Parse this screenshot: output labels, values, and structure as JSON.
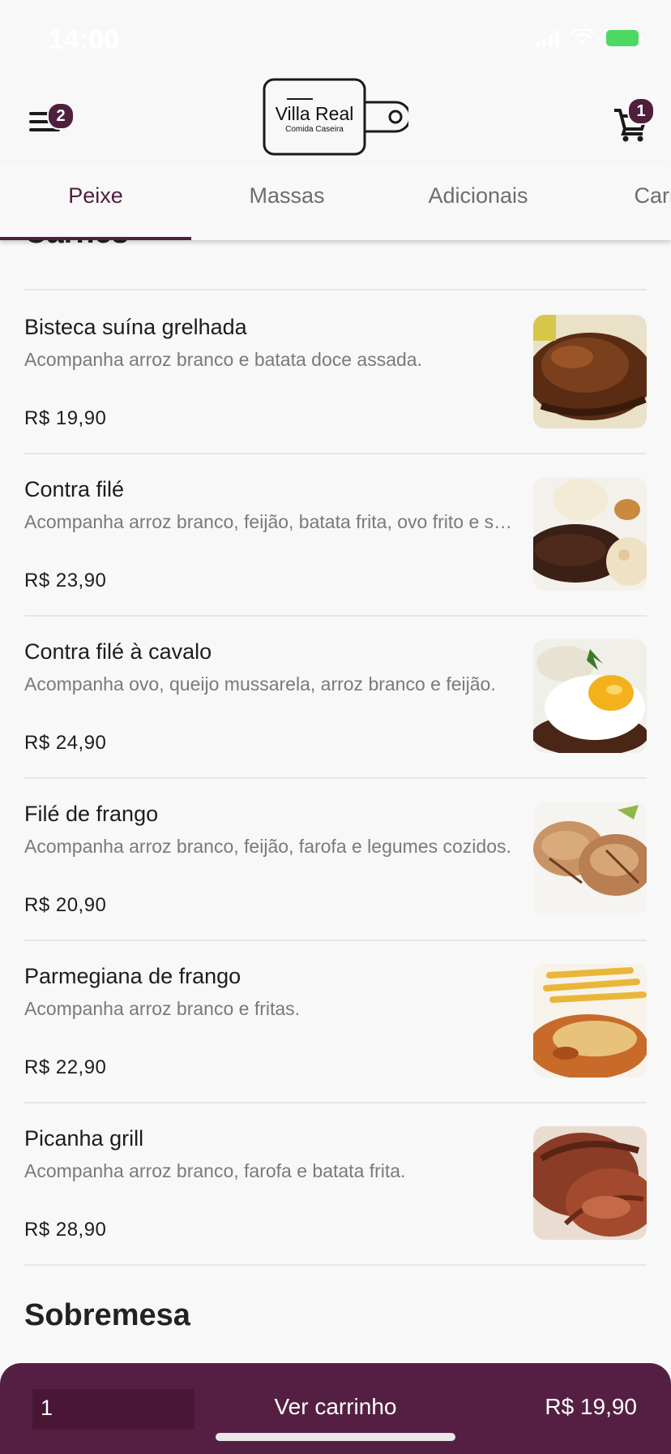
{
  "status": {
    "time": "14:00"
  },
  "header": {
    "menu_badge": "2",
    "cart_badge": "1",
    "logo_title": "Villa Real",
    "logo_subtitle": "Comida Caseira"
  },
  "tabs": [
    {
      "label": "Peixe",
      "active": true
    },
    {
      "label": "Massas",
      "active": false
    },
    {
      "label": "Adicionais",
      "active": false
    },
    {
      "label": "Carnes",
      "active": false
    }
  ],
  "sections": {
    "carnes_title": "Carnes",
    "sobremesa_title": "Sobremesa"
  },
  "items": [
    {
      "name": "Bisteca suína grelhada",
      "description": "Acompanha arroz branco e batata doce assada.",
      "price": "R$ 19,90"
    },
    {
      "name": "Contra filé",
      "description": "Acompanha arroz branco, feijão, batata frita, ovo frito e salada.",
      "price": "R$ 23,90"
    },
    {
      "name": "Contra filé à cavalo",
      "description": "Acompanha ovo, queijo mussarela, arroz branco e feijão.",
      "price": "R$ 24,90"
    },
    {
      "name": "Filé de frango",
      "description": "Acompanha arroz branco, feijão, farofa e legumes cozidos.",
      "price": "R$ 20,90"
    },
    {
      "name": "Parmegiana de frango",
      "description": "Acompanha arroz branco e fritas.",
      "price": "R$ 22,90"
    },
    {
      "name": "Picanha grill",
      "description": "Acompanha arroz branco, farofa e batata frita.",
      "price": "R$ 28,90"
    }
  ],
  "cart": {
    "quantity": "1",
    "label": "Ver carrinho",
    "total": "R$ 19,90"
  },
  "colors": {
    "brand": "#551f43",
    "background": "#f8f8f8"
  },
  "icons": {
    "menu": "hamburger-icon",
    "cart": "cart-icon"
  }
}
